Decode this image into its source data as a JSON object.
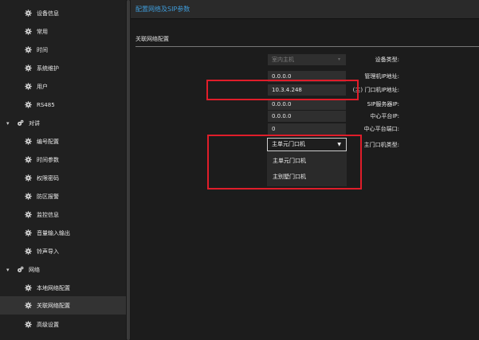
{
  "sidebar": {
    "items": [
      {
        "label": "设备信息",
        "icon": "gear-icon"
      },
      {
        "label": "常用",
        "icon": "gear-icon"
      },
      {
        "label": "时间",
        "icon": "gear-icon"
      },
      {
        "label": "系统维护",
        "icon": "gear-icon"
      },
      {
        "label": "用户",
        "icon": "gear-icon"
      },
      {
        "label": "RS485",
        "icon": "gear-icon"
      },
      {
        "label": "对讲",
        "icon": "settings-group-icon",
        "expanded": true
      },
      {
        "label": "编号配置",
        "icon": "gear-icon"
      },
      {
        "label": "时间参数",
        "icon": "gear-icon"
      },
      {
        "label": "权限密码",
        "icon": "gear-icon"
      },
      {
        "label": "防区报警",
        "icon": "gear-icon"
      },
      {
        "label": "监控信息",
        "icon": "gear-icon"
      },
      {
        "label": "音量输入输出",
        "icon": "gear-icon"
      },
      {
        "label": "铃声导入",
        "icon": "gear-icon"
      },
      {
        "label": "网络",
        "icon": "settings-group-icon",
        "expanded": true
      },
      {
        "label": "本地网络配置",
        "icon": "gear-icon"
      },
      {
        "label": "关联网络配置",
        "icon": "gear-icon",
        "active": true
      },
      {
        "label": "高级设置",
        "icon": "gear-icon"
      }
    ]
  },
  "header": {
    "title": "配置网络及SIP参数"
  },
  "section": {
    "title": "关联网络配置"
  },
  "form": {
    "device_type": {
      "label": "设备类型:",
      "value": "室内主机"
    },
    "manager_ip": {
      "label": "管理机IP地址:",
      "value": "0.0.0.0"
    },
    "door_ip": {
      "label": "(主) 门口机IP地址:",
      "value": "10.3.4.248"
    },
    "sip_ip": {
      "label": "SIP服务器IP:",
      "value": "0.0.0.0"
    },
    "center_ip": {
      "label": "中心平台IP:",
      "value": "0.0.0.0"
    },
    "center_port": {
      "label": "中心平台端口:",
      "value": "0"
    },
    "door_type": {
      "label": "主门口机类型:",
      "value": "主单元门口机",
      "options": [
        "主单元门口机",
        "主别墅门口机"
      ]
    }
  },
  "colors": {
    "accent": "#3f9bd8",
    "highlight_box": "#e01d2a"
  }
}
